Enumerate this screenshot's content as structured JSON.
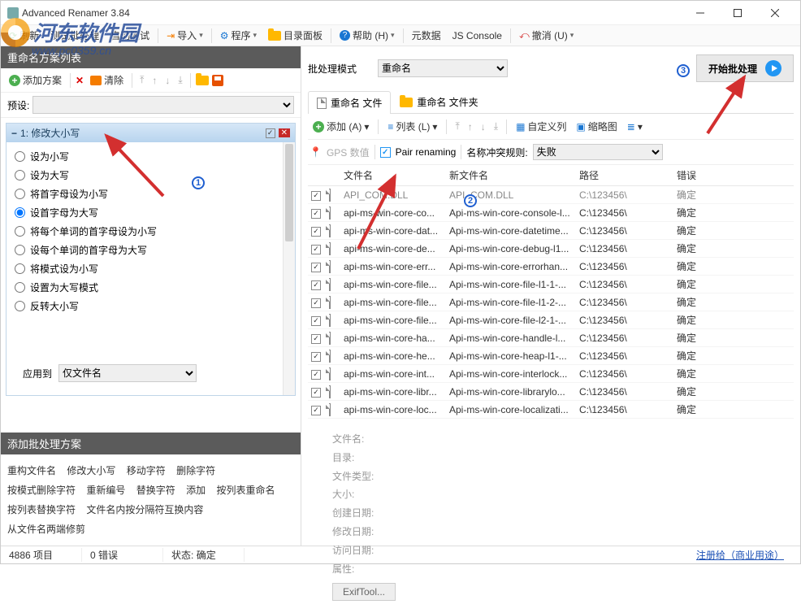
{
  "window": {
    "title": "Advanced Renamer 3.84"
  },
  "menu": {
    "refresh": "刷新",
    "test": "测试批处理",
    "autotest": "自动测试",
    "import": "导入",
    "program": "程序",
    "dirpanel": "目录面板",
    "help": "帮助 (H)",
    "metadata": "元数据",
    "jsconsole": "JS Console",
    "undo": "撤消 (U)"
  },
  "left": {
    "header": "重命名方案列表",
    "add_method": "添加方案",
    "clear": "清除",
    "preset_label": "预设:",
    "method_title": "1: 修改大小写",
    "options": {
      "o1": "设为小写",
      "o2": "设为大写",
      "o3": "将首字母设为小写",
      "o4": "设首字母为大写",
      "o5": "将每个单词的首字母设为小写",
      "o6": "设每个单词的首字母为大写",
      "o7": "将模式设为小写",
      "o8": "设置为大写模式",
      "o9": "反转大小写"
    },
    "applyto_label": "应用到",
    "applyto_value": "仅文件名",
    "bottom_header": "添加批处理方案",
    "links": {
      "l1": "重构文件名",
      "l2": "修改大小写",
      "l3": "移动字符",
      "l4": "删除字符",
      "l5": "按模式删除字符",
      "l6": "重新编号",
      "l7": "替换字符",
      "l8": "添加",
      "l9": "按列表重命名",
      "l10": "按列表替换字符",
      "l11": "文件名内按分隔符互换内容",
      "l12": "从文件名两端修剪"
    }
  },
  "right": {
    "mode_label": "批处理模式",
    "mode_value": "重命名",
    "start_label": "开始批处理",
    "tab_files": "重命名 文件",
    "tab_folders": "重命名 文件夹",
    "tb": {
      "add": "添加 (A)",
      "list": "列表 (L)",
      "customcol": "自定义列",
      "thumbs": "缩略图"
    },
    "filter": {
      "gps": "GPS 数值",
      "pair": "Pair renaming",
      "rule_label": "名称冲突规则:",
      "rule_value": "失败"
    },
    "columns": {
      "c1": "文件名",
      "c2": "新文件名",
      "c3": "路径",
      "c4": "错误"
    },
    "rows": [
      {
        "name": "API_COM.DLL",
        "newname": "API_COM.DLL",
        "path": "C:\\123456\\",
        "err": "确定",
        "gray": true
      },
      {
        "name": "api-ms-win-core-co...",
        "newname": "Api-ms-win-core-console-l...",
        "path": "C:\\123456\\",
        "err": "确定",
        "anno": true
      },
      {
        "name": "api-ms-win-core-dat...",
        "newname": "Api-ms-win-core-datetime...",
        "path": "C:\\123456\\",
        "err": "确定"
      },
      {
        "name": "api-ms-win-core-de...",
        "newname": "Api-ms-win-core-debug-l1...",
        "path": "C:\\123456\\",
        "err": "确定"
      },
      {
        "name": "api-ms-win-core-err...",
        "newname": "Api-ms-win-core-errorhan...",
        "path": "C:\\123456\\",
        "err": "确定"
      },
      {
        "name": "api-ms-win-core-file...",
        "newname": "Api-ms-win-core-file-l1-1-...",
        "path": "C:\\123456\\",
        "err": "确定"
      },
      {
        "name": "api-ms-win-core-file...",
        "newname": "Api-ms-win-core-file-l1-2-...",
        "path": "C:\\123456\\",
        "err": "确定"
      },
      {
        "name": "api-ms-win-core-file...",
        "newname": "Api-ms-win-core-file-l2-1-...",
        "path": "C:\\123456\\",
        "err": "确定"
      },
      {
        "name": "api-ms-win-core-ha...",
        "newname": "Api-ms-win-core-handle-l...",
        "path": "C:\\123456\\",
        "err": "确定"
      },
      {
        "name": "api-ms-win-core-he...",
        "newname": "Api-ms-win-core-heap-l1-...",
        "path": "C:\\123456\\",
        "err": "确定"
      },
      {
        "name": "api-ms-win-core-int...",
        "newname": "Api-ms-win-core-interlock...",
        "path": "C:\\123456\\",
        "err": "确定"
      },
      {
        "name": "api-ms-win-core-libr...",
        "newname": "Api-ms-win-core-librarylo...",
        "path": "C:\\123456\\",
        "err": "确定"
      },
      {
        "name": "api-ms-win-core-loc...",
        "newname": "Api-ms-win-core-localizati...",
        "path": "C:\\123456\\",
        "err": "确定"
      }
    ],
    "props": {
      "p1": "文件名:",
      "p2": "目录:",
      "p3": "文件类型:",
      "p4": "大小:",
      "p5": "创建日期:",
      "p6": "修改日期:",
      "p7": "访问日期:",
      "p8": "属性:",
      "exif": "ExifTool..."
    }
  },
  "status": {
    "items": "4886 项目",
    "errors": "0 错误",
    "state_label": "状态:",
    "state_value": "确定",
    "register": "注册给（商业用途）"
  },
  "watermark": {
    "text": "河东软件园",
    "url": "www.pc0359.cn"
  }
}
